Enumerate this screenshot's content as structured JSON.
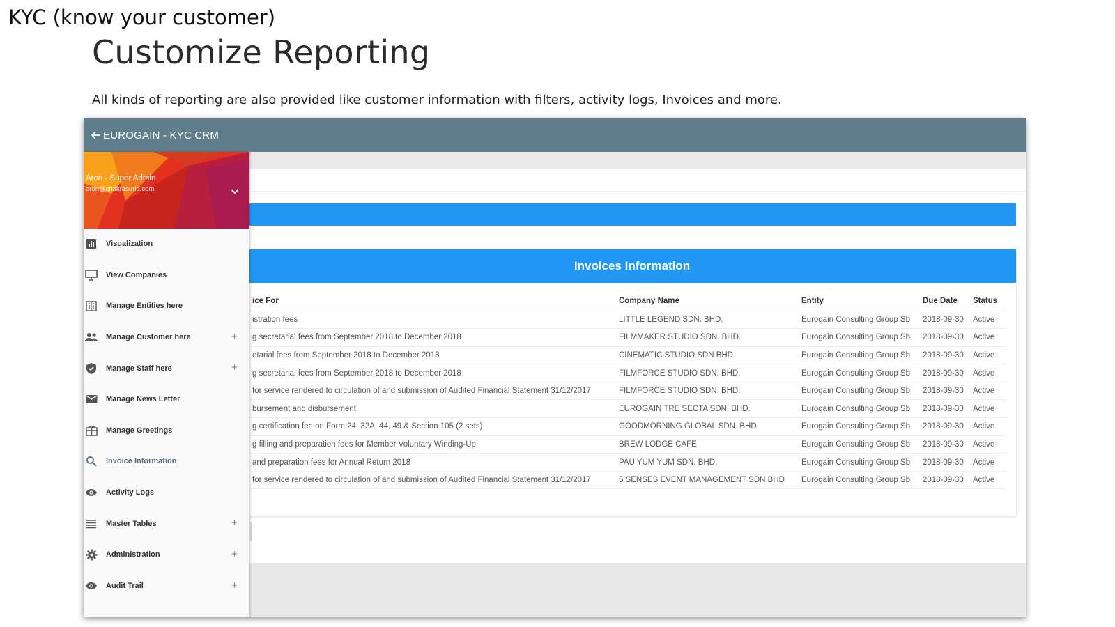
{
  "slide": {
    "heading": "KYC (know your customer)",
    "title": "Customize Reporting",
    "description": "All kinds of reporting are also provided like customer information with filters, activity logs, Invoices and more."
  },
  "app": {
    "title": "EUROGAIN - KYC CRM",
    "back_icon": "arrow-left-icon"
  },
  "profile": {
    "name": "Aron - Super Admin",
    "email": "aron@chakrasuria.com",
    "colors": [
      "#f9a11b",
      "#e2321f",
      "#a81c4f"
    ]
  },
  "sidebar": {
    "items": [
      {
        "label": "Visualization",
        "icon": "bar-chart-icon",
        "expandable": false
      },
      {
        "label": "View Companies",
        "icon": "monitor-icon",
        "expandable": false
      },
      {
        "label": "Manage Entities here",
        "icon": "building-icon",
        "expandable": false
      },
      {
        "label": "Manage Customer here",
        "icon": "people-icon",
        "expandable": true
      },
      {
        "label": "Manage Staff here",
        "icon": "shield-icon",
        "expandable": true
      },
      {
        "label": "Manage News Letter",
        "icon": "mail-icon",
        "expandable": false
      },
      {
        "label": "Manage Greetings",
        "icon": "gift-card-icon",
        "expandable": false
      },
      {
        "label": "Invoice Information",
        "icon": "search-icon",
        "expandable": false,
        "active": true
      },
      {
        "label": "Activity Logs",
        "icon": "eye-icon",
        "expandable": false
      },
      {
        "label": "Master Tables",
        "icon": "list-icon",
        "expandable": true
      },
      {
        "label": "Administration",
        "icon": "gear-icon",
        "expandable": true
      },
      {
        "label": "Audit Trail",
        "icon": "eye-icon",
        "expandable": true
      }
    ],
    "expand_symbol": "+"
  },
  "invoices": {
    "header": "Invoices Information",
    "columns": [
      "ice For",
      "Company Name",
      "Entity",
      "Due Date",
      "Status"
    ],
    "rows": [
      [
        "istration fees",
        "LITTLE LEGEND SDN. BHD.",
        "Eurogain Consulting Group Sb",
        "2018-09-30",
        "Active"
      ],
      [
        "g secretarial fees from September 2018 to December 2018",
        "FILMMAKER STUDIO SDN. BHD.",
        "Eurogain Consulting Group Sb",
        "2018-09-30",
        "Active"
      ],
      [
        "etarial fees from September 2018 to December 2018",
        "CINEMATIC STUDIO SDN BHD",
        "Eurogain Consulting Group Sb",
        "2018-09-30",
        "Active"
      ],
      [
        "g secretarial fees from September 2018 to December 2018",
        "FILMFORCE STUDIO SDN. BHD.",
        "Eurogain Consulting Group Sb",
        "2018-09-30",
        "Active"
      ],
      [
        " for service rendered to circulation of and submission of Audited Financial Statement 31/12/2017",
        "FILMFORCE STUDIO SDN. BHD.",
        "Eurogain Consulting Group Sb",
        "2018-09-30",
        "Active"
      ],
      [
        "bursement and disbursement",
        "EUROGAIN TRE SECTA SDN. BHD.",
        "Eurogain Consulting Group Sb",
        "2018-09-30",
        "Active"
      ],
      [
        "g certification fee on Form 24, 32A, 44, 49 & Section 105 (2 sets)",
        "GOODMORNING GLOBAL SDN. BHD.",
        "Eurogain Consulting Group Sb",
        "2018-09-30",
        "Active"
      ],
      [
        "g filling and preparation fees for Member Voluntary Winding-Up",
        "BREW LODGE CAFE",
        "Eurogain Consulting Group Sb",
        "2018-09-30",
        "Active"
      ],
      [
        " and preparation fees for Annual Return 2018",
        "PAU YUM YUM SDN. BHD.",
        "Eurogain Consulting Group Sb",
        "2018-09-30",
        "Active"
      ],
      [
        " for service rendered to circulation of and submission of Audited Financial Statement 31/12/2017",
        "5 SENSES EVENT MANAGEMENT SDN BHD",
        "Eurogain Consulting Group Sb",
        "2018-09-30",
        "Active"
      ]
    ]
  },
  "colors": {
    "topbar": "#607d8b",
    "accent_blue": "#2196f3",
    "active_item": "#5a6f80"
  }
}
